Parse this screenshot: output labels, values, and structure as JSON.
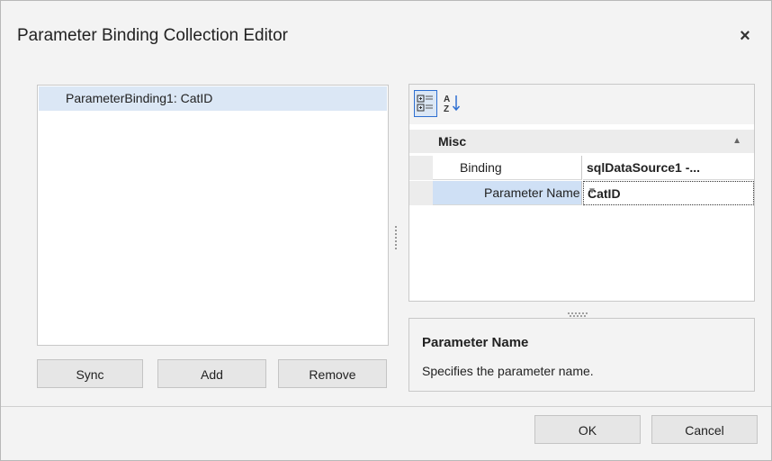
{
  "window": {
    "title": "Parameter Binding Collection Editor",
    "close_glyph": "×"
  },
  "list": {
    "items": [
      "ParameterBinding1: CatID"
    ]
  },
  "list_buttons": {
    "sync": "Sync",
    "add": "Add",
    "remove": "Remove"
  },
  "property_grid": {
    "category": "Misc",
    "rows": [
      {
        "name": "Binding",
        "value": "sqlDataSource1 -..."
      },
      {
        "name": "Parameter Name",
        "value": "CatID"
      }
    ]
  },
  "description": {
    "title": "Parameter Name",
    "text": "Specifies the parameter name."
  },
  "footer_buttons": {
    "ok": "OK",
    "cancel": "Cancel"
  },
  "colors": {
    "selection": "#dbe7f5",
    "accent": "#2e6fd1"
  }
}
